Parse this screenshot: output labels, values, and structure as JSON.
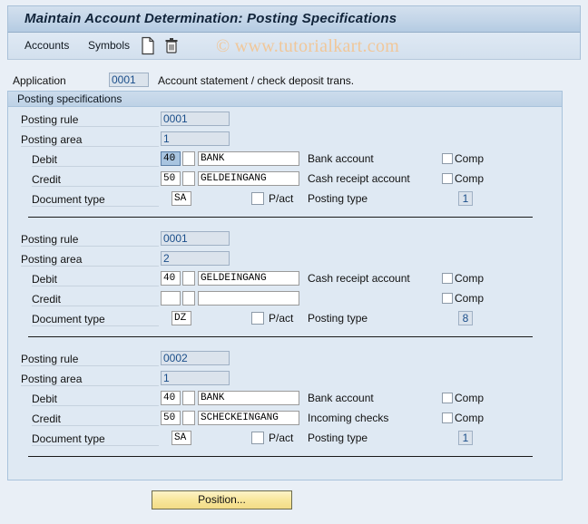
{
  "window": {
    "title": "Maintain Account Determination: Posting Specifications"
  },
  "toolbar": {
    "accounts_label": "Accounts",
    "symbols_label": "Symbols",
    "new_icon": "document-icon",
    "delete_icon": "trash-icon"
  },
  "watermark": "© www.tutorialkart.com",
  "application": {
    "label": "Application",
    "value": "0001",
    "description": "Account statement / check deposit trans."
  },
  "panel": {
    "header": "Posting specifications",
    "labels": {
      "posting_rule": "Posting rule",
      "posting_area": "Posting area",
      "debit": "Debit",
      "credit": "Credit",
      "document_type": "Document type",
      "pact": "P/act",
      "posting_type": "Posting type",
      "comp": "Comp"
    },
    "blocks": [
      {
        "posting_rule": "0001",
        "posting_area": "1",
        "debit": {
          "key": "40",
          "key_focused": true,
          "modifier": "",
          "symbol": "BANK",
          "description": "Bank account",
          "comp_checked": false
        },
        "credit": {
          "key": "50",
          "key_focused": false,
          "modifier": "",
          "symbol": "GELDEINGANG",
          "description": "Cash receipt account",
          "comp_checked": false
        },
        "document_type": "SA",
        "pact_checked": false,
        "posting_type": "1"
      },
      {
        "posting_rule": "0001",
        "posting_area": "2",
        "debit": {
          "key": "40",
          "key_focused": false,
          "modifier": "",
          "symbol": "GELDEINGANG",
          "description": "Cash receipt account",
          "comp_checked": false
        },
        "credit": {
          "key": "",
          "key_focused": false,
          "modifier": "",
          "symbol": "",
          "description": "",
          "comp_checked": false
        },
        "document_type": "DZ",
        "pact_checked": false,
        "posting_type": "8"
      },
      {
        "posting_rule": "0002",
        "posting_area": "1",
        "debit": {
          "key": "40",
          "key_focused": false,
          "modifier": "",
          "symbol": "BANK",
          "description": "Bank account",
          "comp_checked": false
        },
        "credit": {
          "key": "50",
          "key_focused": false,
          "modifier": "",
          "symbol": "SCHECKEINGANG",
          "description": "Incoming checks",
          "comp_checked": false
        },
        "document_type": "SA",
        "pact_checked": false,
        "posting_type": "1"
      }
    ]
  },
  "footer": {
    "position_button": "Position..."
  },
  "colors": {
    "page_bg": "#e9eff6",
    "panel_bg": "#dfe9f3",
    "title_grad_top": "#d3e0ee",
    "readonly_field": "#dbe3ec",
    "readonly_text": "#1a4e8a",
    "selection": "#a8c4e0",
    "button": "#f8e79c",
    "watermark": "#f0c79a"
  }
}
